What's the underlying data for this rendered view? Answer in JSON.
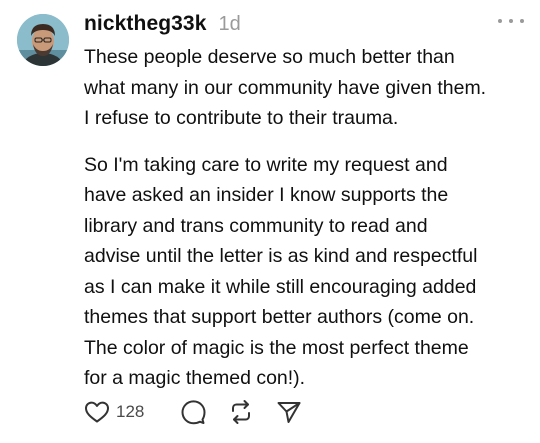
{
  "post": {
    "username": "nicktheg33k",
    "timestamp": "1d",
    "paragraphs": [
      "These people deserve so much better than\nwhat many in our community have given them.\nI refuse to contribute to their trauma.",
      "So I'm taking care to write my request and\nhave asked an insider I know supports the\nlibrary and trans community to read and\nadvise until the letter is as kind and respectful\nas I can make it while still encouraging added\nthemes that support better authors (come on.\nThe color of magic is the most perfect theme\nfor a magic themed con!)."
    ],
    "like_count": "128"
  },
  "icons": {
    "avatar": "user-avatar",
    "more": "more-options-icon",
    "like": "heart-icon",
    "reply": "comment-bubble-icon",
    "repost": "repost-arrows-icon",
    "share": "send-icon"
  },
  "colors": {
    "text": "#101010",
    "muted": "#9a9a9a",
    "icon": "#333333"
  }
}
